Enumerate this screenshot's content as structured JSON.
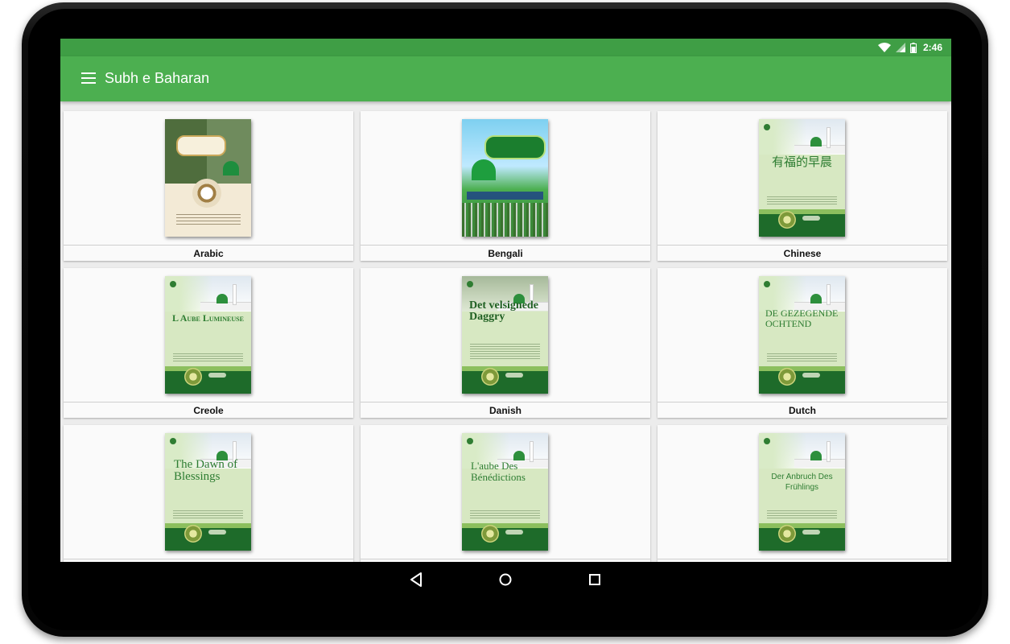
{
  "statusbar": {
    "time": "2:46"
  },
  "appbar": {
    "title": "Subh e Baharan",
    "menu_icon": "hamburger-menu-icon"
  },
  "books": [
    {
      "label": "Arabic",
      "cover_text": "",
      "style": "arabic"
    },
    {
      "label": "Bengali",
      "cover_text": "",
      "style": "bengali"
    },
    {
      "label": "Chinese",
      "cover_text": "有福的早晨",
      "style": "cjk"
    },
    {
      "label": "Creole",
      "cover_text": "L Aube Lumineuse",
      "style": "small"
    },
    {
      "label": "Danish",
      "cover_text": "Det velsignede Daggry",
      "style": "danish"
    },
    {
      "label": "Dutch",
      "cover_text": "DE GEZEGENDE OCHTEND",
      "style": "serif"
    },
    {
      "label": "",
      "cover_text": "The Dawn of Blessings",
      "style": "serif"
    },
    {
      "label": "",
      "cover_text": "L'aube Des Bénédictions",
      "style": "serif"
    },
    {
      "label": "",
      "cover_text": "Der Anbruch Des Frühlings",
      "style": "sans"
    }
  ],
  "navbar": {
    "back_icon": "back-triangle-icon",
    "home_icon": "home-circle-icon",
    "recents_icon": "recents-square-icon"
  },
  "colors": {
    "primary": "#4caf50",
    "primary_dark": "#3f9e45",
    "cover_green": "#2e7d32"
  }
}
